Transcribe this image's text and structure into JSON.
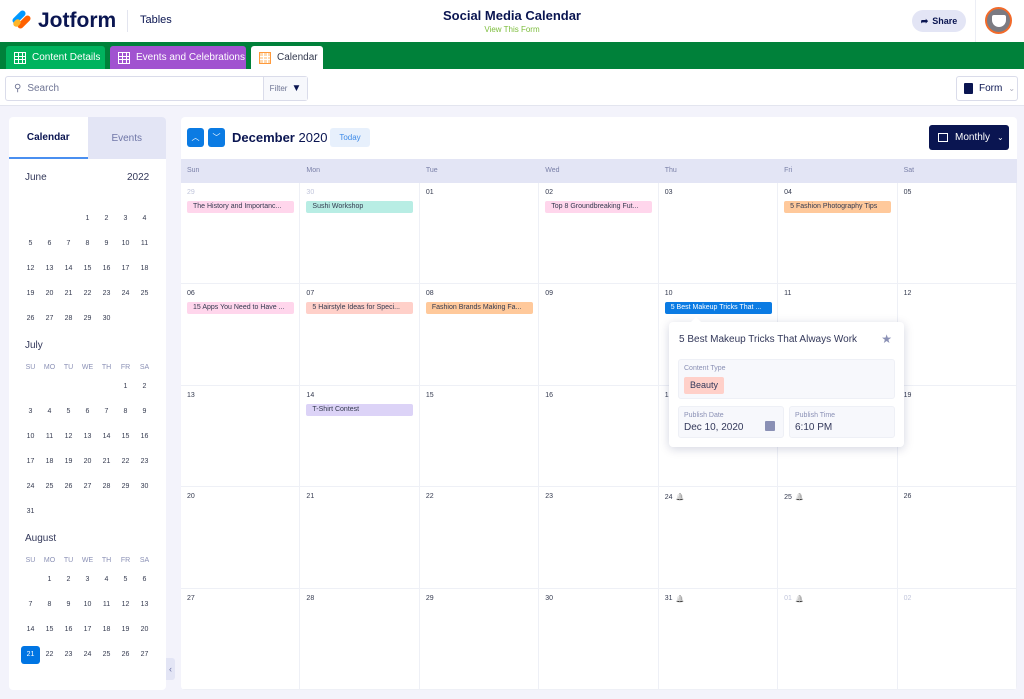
{
  "header": {
    "brand": "Jotform",
    "section": "Tables",
    "title": "Social Media Calendar",
    "subtitle": "View This Form",
    "share_label": "Share"
  },
  "tabs": [
    {
      "label": "Content Details",
      "color": "#00b35e",
      "icon": "grid-icon"
    },
    {
      "label": "Events and Celebrations",
      "color": "#a153d0",
      "icon": "grid-icon"
    },
    {
      "label": "Calendar",
      "color": "#ffffff",
      "icon": "calendar-icon",
      "active": true
    }
  ],
  "toolbar": {
    "search_placeholder": "Search",
    "filter_label": "Filter",
    "form_label": "Form"
  },
  "sidebar": {
    "tabs": [
      "Calendar",
      "Events"
    ],
    "year": "2022",
    "weekdays": [
      "SU",
      "MO",
      "TU",
      "WE",
      "TH",
      "FR",
      "SA"
    ],
    "months": [
      {
        "name": "June",
        "start": 3,
        "days": 30,
        "show_weekdays": false
      },
      {
        "name": "July",
        "start": 5,
        "days": 31,
        "show_weekdays": true
      },
      {
        "name": "August",
        "start": 1,
        "days": 27,
        "show_weekdays": true
      }
    ],
    "selected": {
      "month": "August",
      "day": 21
    }
  },
  "calendar": {
    "month": "December",
    "year": "2020",
    "today_label": "Today",
    "view_label": "Monthly",
    "weekdays": [
      "Sun",
      "Mon",
      "Tue",
      "Wed",
      "Thu",
      "Fri",
      "Sat"
    ],
    "weeks": [
      [
        {
          "d": "29",
          "dim": true,
          "ev": "The History and Importanc...",
          "c": "#ffd6ec"
        },
        {
          "d": "30",
          "dim": true,
          "ev": "Sushi Workshop",
          "c": "#b8ede4"
        },
        {
          "d": "01"
        },
        {
          "d": "02",
          "ev": "Top 8 Groundbreaking Fut...",
          "c": "#ffd6ec"
        },
        {
          "d": "03"
        },
        {
          "d": "04",
          "ev": "5 Fashion Photography Tips",
          "c": "#ffc99b"
        },
        {
          "d": "05"
        }
      ],
      [
        {
          "d": "06",
          "ev": "15 Apps You Need to Have ...",
          "c": "#ffd6ec"
        },
        {
          "d": "07",
          "ev": "5 Hairstyle Ideas for Speci...",
          "c": "#ffd0c9"
        },
        {
          "d": "08",
          "ev": "Fashion Brands Making Fa...",
          "c": "#ffc99b"
        },
        {
          "d": "09"
        },
        {
          "d": "10",
          "ev": "5 Best Makeup Tricks That ...",
          "c": "#0b7be3",
          "light": true
        },
        {
          "d": "11"
        },
        {
          "d": "12"
        }
      ],
      [
        {
          "d": "13"
        },
        {
          "d": "14",
          "ev": "T-Shirt Contest",
          "c": "#dcd3f7"
        },
        {
          "d": "15"
        },
        {
          "d": "16"
        },
        {
          "d": "17"
        },
        {
          "d": "18"
        },
        {
          "d": "19"
        }
      ],
      [
        {
          "d": "20"
        },
        {
          "d": "21"
        },
        {
          "d": "22"
        },
        {
          "d": "23"
        },
        {
          "d": "24",
          "bell": true
        },
        {
          "d": "25",
          "bell": true
        },
        {
          "d": "26"
        }
      ],
      [
        {
          "d": "27"
        },
        {
          "d": "28"
        },
        {
          "d": "29"
        },
        {
          "d": "30"
        },
        {
          "d": "31",
          "bell": true
        },
        {
          "d": "01",
          "dim": true,
          "bell": true
        },
        {
          "d": "02",
          "dim": true
        }
      ]
    ]
  },
  "popup": {
    "title": "5 Best Makeup Tricks That Always Work",
    "content_type_label": "Content Type",
    "content_type": "Beauty",
    "publish_date_label": "Publish Date",
    "publish_date": "Dec 10, 2020",
    "publish_time_label": "Publish Time",
    "publish_time": "6:10 PM"
  }
}
